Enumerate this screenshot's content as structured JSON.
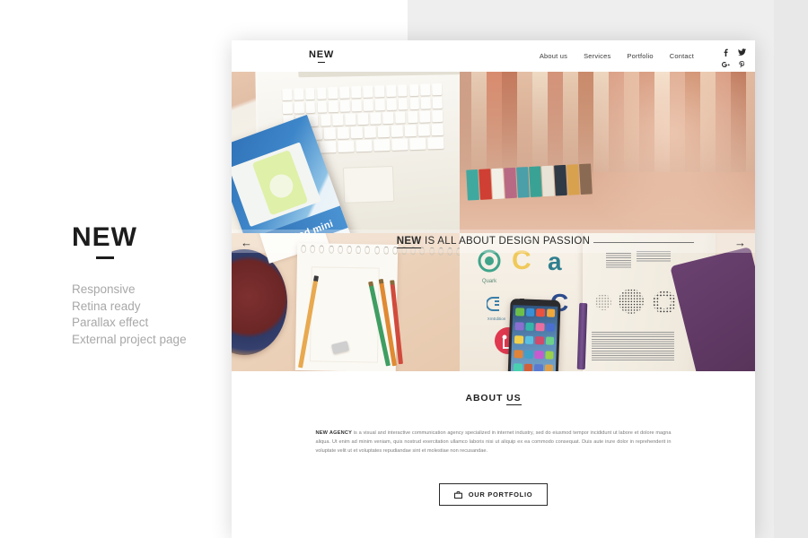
{
  "promo": {
    "logo": "NEW",
    "features": [
      "Responsive",
      "Retina ready",
      "Parallax effect",
      "External project page"
    ]
  },
  "site": {
    "logo": "NEW",
    "nav": [
      {
        "label": "About us"
      },
      {
        "label": "Services"
      },
      {
        "label": "Portfolio"
      },
      {
        "label": "Contact"
      }
    ],
    "social": [
      {
        "name": "facebook-icon",
        "glyph": "f"
      },
      {
        "name": "twitter-icon",
        "glyph": "t"
      },
      {
        "name": "google-plus-icon",
        "glyph": "g+"
      },
      {
        "name": "pinterest-icon",
        "glyph": "p"
      }
    ],
    "hero": {
      "caption_strong": "NEW",
      "caption_rest": " IS ALL ABOUT DESIGN PASSION",
      "prev_arrow": "←",
      "next_arrow": "→",
      "slides": [
        {
          "name": "laptop-ipod-book",
          "alt": "White laptop keyboard with blue iPod and iPod mini book"
        },
        {
          "name": "book-spines",
          "alt": "Row of vertical book spines in warm tones"
        },
        {
          "name": "notepad-pencils",
          "alt": "Spiral notepad with pencils, eraser and decorative plate"
        },
        {
          "name": "logo-book-phone",
          "alt": "Logo design book with Quark, C, a, LG marks and an iPhone"
        },
        {
          "name": "open-book-halftone",
          "alt": "Open book showing halftone circle patterns and purple pen"
        }
      ]
    },
    "about": {
      "title_plain": "ABOUT ",
      "title_underlined": "US",
      "lead": "NEW AGENCY",
      "body": " is a visual and interactive communication agency specialized in internet industry, sed do eiusmod tempor incididunt ut labore et dolore magna aliqua. Ut enim ad minim veniam, quis nostrud exercitation ullamco laboris nisi ut aliquip ex ea commodo consequat. Duis aute irure dolor in reprehenderit in voluptate velit ut et voluptates repudiandae sint et molestiae non recusandae.",
      "button_label": "OUR PORTFOLIO",
      "button_icon": "briefcase-icon"
    }
  },
  "colors": {
    "backdrop_gray": "#eeeeee",
    "page_white": "#ffffff",
    "text_dark": "#1c1c1c",
    "text_muted": "#a8a8a8",
    "body_text": "#7d7d7d"
  }
}
